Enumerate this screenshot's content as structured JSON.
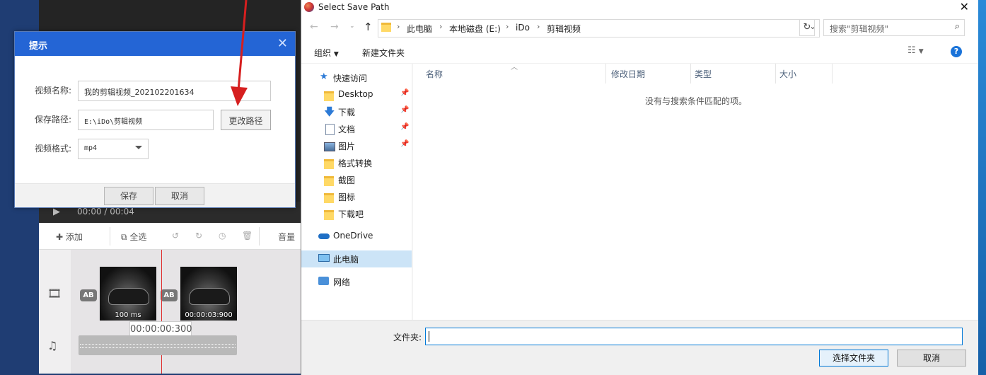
{
  "editor": {
    "time_current": "00:00",
    "time_sep": " / ",
    "time_total": "00:04",
    "toolbar": {
      "add_label": "添加",
      "select_all_label": "全选",
      "volume_label": "音量"
    },
    "clips": [
      {
        "duration": "100 ms"
      },
      {
        "duration": "00:00:03:900"
      }
    ],
    "transition_label": "AB",
    "playhead_time": "00:00:00:300"
  },
  "prompt_dialog": {
    "title": "提示",
    "name_label": "视频名称:",
    "name_value": "我的剪辑视频_202102201634",
    "path_label": "保存路径:",
    "path_value": "E:\\iDo\\剪辑视频",
    "change_path_button": "更改路径",
    "format_label": "视频格式:",
    "format_value": "mp4",
    "save_button": "保存",
    "cancel_button": "取消"
  },
  "save_dialog": {
    "title": "Select Save Path",
    "breadcrumbs": [
      "此电脑",
      "本地磁盘 (E:)",
      "iDo",
      "剪辑视频"
    ],
    "search_placeholder": "搜索\"剪辑视频\"",
    "organize_label": "组织",
    "new_folder_label": "新建文件夹",
    "nav": {
      "quick_access": "快速访问",
      "items": [
        {
          "label": "Desktop",
          "icon": "folder-icon",
          "pinned": true
        },
        {
          "label": "下载",
          "icon": "download-arrow-icon",
          "pinned": true
        },
        {
          "label": "文档",
          "icon": "document-icon",
          "pinned": true
        },
        {
          "label": "图片",
          "icon": "picture-icon",
          "pinned": true
        },
        {
          "label": "格式转换",
          "icon": "folder-icon",
          "pinned": false
        },
        {
          "label": "截图",
          "icon": "folder-icon",
          "pinned": false
        },
        {
          "label": "图标",
          "icon": "folder-icon",
          "pinned": false
        },
        {
          "label": "下载吧",
          "icon": "folder-icon",
          "pinned": false
        }
      ],
      "onedrive": "OneDrive",
      "this_pc": "此电脑",
      "network": "网络"
    },
    "columns": [
      "名称",
      "修改日期",
      "类型",
      "大小"
    ],
    "empty_message": "没有与搜索条件匹配的项。",
    "folder_label": "文件夹:",
    "folder_value": "",
    "select_button": "选择文件夹",
    "cancel_button": "取消"
  },
  "colors": {
    "dialog_title_blue": "#2465d5",
    "selected_nav": "#cce4f7",
    "help_blue": "#1a73d9",
    "playhead_red": "#e03030"
  }
}
